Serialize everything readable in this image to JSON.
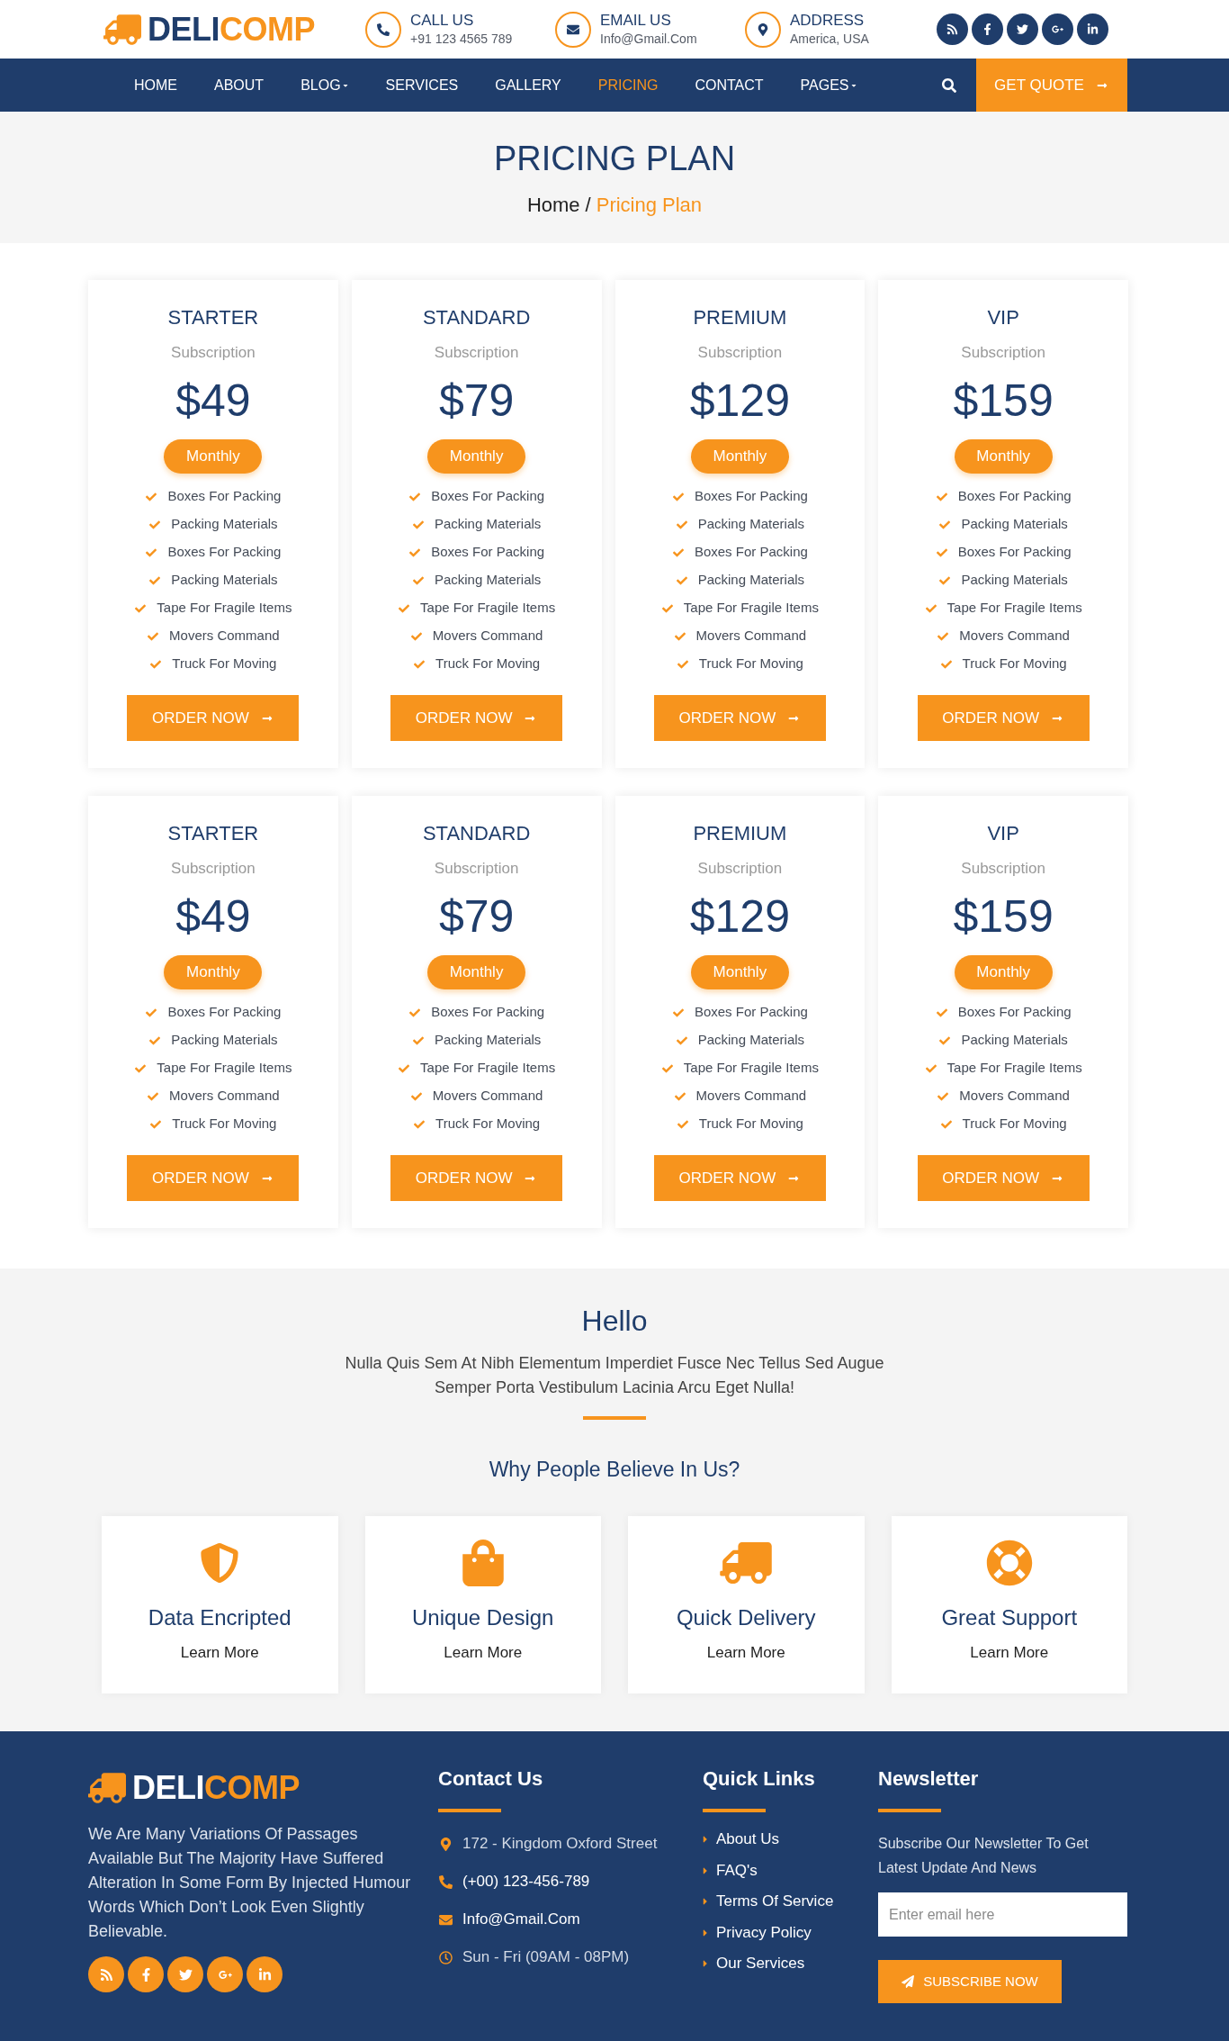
{
  "header": {
    "logo": {
      "part_1": "DELI",
      "part_2": "COMP"
    },
    "contacts": [
      {
        "kind": "phone",
        "label": "CALL US",
        "value": "+91 123 4565 789"
      },
      {
        "kind": "email",
        "label": "EMAIL US",
        "value": "Info@Gmail.Com"
      },
      {
        "kind": "address",
        "label": "ADDRESS",
        "value": "America, USA"
      }
    ]
  },
  "nav": {
    "items": [
      {
        "label": "HOME",
        "selected": false,
        "has_dropdown": false
      },
      {
        "label": "ABOUT",
        "selected": false,
        "has_dropdown": false
      },
      {
        "label": "BLOG",
        "selected": false,
        "has_dropdown": true
      },
      {
        "label": "SERVICES",
        "selected": false,
        "has_dropdown": false
      },
      {
        "label": "GALLERY",
        "selected": false,
        "has_dropdown": false
      },
      {
        "label": "PRICING",
        "selected": true,
        "has_dropdown": false
      },
      {
        "label": "CONTACT",
        "selected": false,
        "has_dropdown": false
      },
      {
        "label": "PAGES",
        "selected": false,
        "has_dropdown": true
      }
    ],
    "cta": "GET QUOTE"
  },
  "page_title": {
    "title": "PRICING PLAN",
    "breadcrumb": [
      {
        "label": "Home",
        "current": false
      },
      {
        "label": "Pricing Plan",
        "current": true
      }
    ],
    "separator": "/"
  },
  "pricing_rows": [
    {
      "plans": [
        {
          "name": "STARTER",
          "subtitle": "Subscription",
          "price": "$49",
          "period": "Monthly",
          "features": [
            "Boxes For Packing",
            "Packing Materials",
            "Boxes For Packing",
            "Packing Materials",
            "Tape For Fragile Items",
            "Movers Command",
            "Truck For Moving"
          ],
          "button": "ORDER NOW"
        },
        {
          "name": "STANDARD",
          "subtitle": "Subscription",
          "price": "$79",
          "period": "Monthly",
          "features": [
            "Boxes For Packing",
            "Packing Materials",
            "Boxes For Packing",
            "Packing Materials",
            "Tape For Fragile Items",
            "Movers Command",
            "Truck For Moving"
          ],
          "button": "ORDER NOW"
        },
        {
          "name": "PREMIUM",
          "subtitle": "Subscription",
          "price": "$129",
          "period": "Monthly",
          "features": [
            "Boxes For Packing",
            "Packing Materials",
            "Boxes For Packing",
            "Packing Materials",
            "Tape For Fragile Items",
            "Movers Command",
            "Truck For Moving"
          ],
          "button": "ORDER NOW"
        },
        {
          "name": "VIP",
          "subtitle": "Subscription",
          "price": "$159",
          "period": "Monthly",
          "features": [
            "Boxes For Packing",
            "Packing Materials",
            "Boxes For Packing",
            "Packing Materials",
            "Tape For Fragile Items",
            "Movers Command",
            "Truck For Moving"
          ],
          "button": "ORDER NOW"
        }
      ]
    },
    {
      "plans": [
        {
          "name": "STARTER",
          "subtitle": "Subscription",
          "price": "$49",
          "period": "Monthly",
          "features": [
            "Boxes For Packing",
            "Packing Materials",
            "Tape For Fragile Items",
            "Movers Command",
            "Truck For Moving"
          ],
          "button": "ORDER NOW"
        },
        {
          "name": "STANDARD",
          "subtitle": "Subscription",
          "price": "$79",
          "period": "Monthly",
          "features": [
            "Boxes For Packing",
            "Packing Materials",
            "Tape For Fragile Items",
            "Movers Command",
            "Truck For Moving"
          ],
          "button": "ORDER NOW"
        },
        {
          "name": "PREMIUM",
          "subtitle": "Subscription",
          "price": "$129",
          "period": "Monthly",
          "features": [
            "Boxes For Packing",
            "Packing Materials",
            "Tape For Fragile Items",
            "Movers Command",
            "Truck For Moving"
          ],
          "button": "ORDER NOW"
        },
        {
          "name": "VIP",
          "subtitle": "Subscription",
          "price": "$159",
          "period": "Monthly",
          "features": [
            "Boxes For Packing",
            "Packing Materials",
            "Tape For Fragile Items",
            "Movers Command",
            "Truck For Moving"
          ],
          "button": "ORDER NOW"
        }
      ]
    }
  ],
  "about": {
    "title": "Hello",
    "text": "Nulla Quis Sem At Nibh Elementum Imperdiet Fusce Nec Tellus Sed Augue Semper Porta Vestibulum Lacinia Arcu Eget Nulla!",
    "subtitle": "Why People Believe In Us?",
    "features": [
      {
        "kind": "shield",
        "title": "Data Encripted",
        "link": "Learn More"
      },
      {
        "kind": "bag",
        "title": "Unique Design",
        "link": "Learn More"
      },
      {
        "kind": "truck",
        "title": "Quick Delivery",
        "link": "Learn More"
      },
      {
        "kind": "support",
        "title": "Great Support",
        "link": "Learn More"
      }
    ]
  },
  "footer": {
    "logo": {
      "part_1": "DELI",
      "part_2": "COMP"
    },
    "description": "We Are Many Variations Of Passages Available But The Majority Have Suffered Alteration In Some Form By Injected Humour Words Which Don’t Look Even Slightly Believable.",
    "contact": {
      "title": "Contact Us",
      "items": [
        {
          "kind": "location",
          "text": "172 - Kingdom Oxford Street",
          "is_link": false
        },
        {
          "kind": "phone",
          "text": "(+00) 123-456-789",
          "is_link": true
        },
        {
          "kind": "email",
          "text": "Info@Gmail.Com",
          "is_link": true
        },
        {
          "kind": "hours",
          "text": "Sun - Fri (09AM - 08PM)",
          "is_link": false
        }
      ]
    },
    "quick_links": {
      "title": "Quick Links",
      "items": [
        "About Us",
        "FAQ's",
        "Terms Of Service",
        "Privacy Policy",
        "Our Services"
      ]
    },
    "newsletter": {
      "title": "Newsletter",
      "text": "Subscribe Our Newsletter To Get Latest Update And News",
      "placeholder": "Enter email here",
      "button": "SUBSCRIBE NOW"
    }
  }
}
